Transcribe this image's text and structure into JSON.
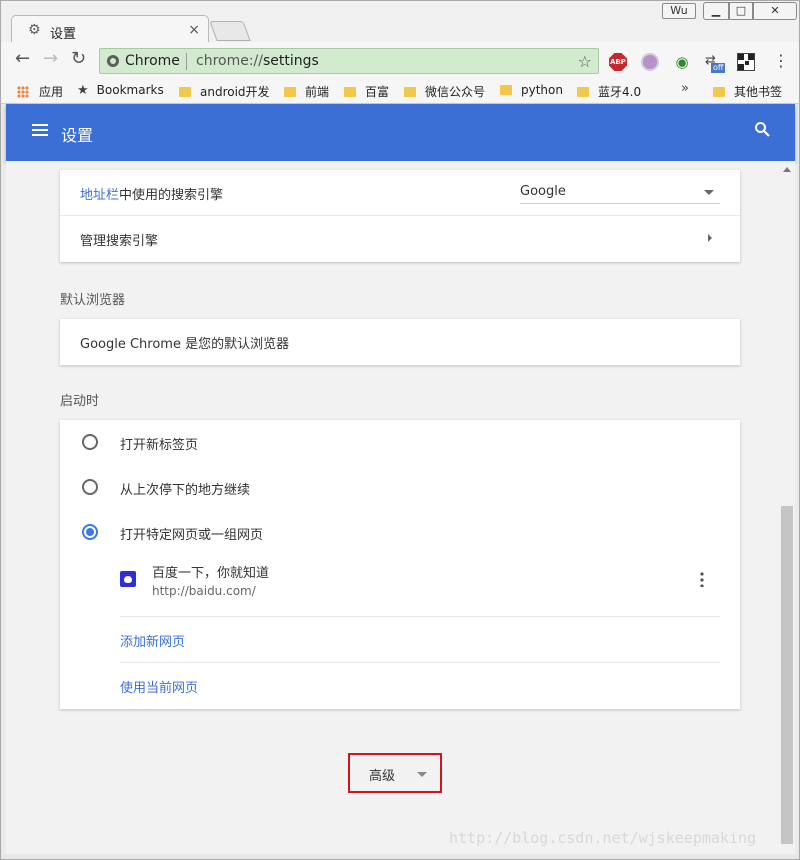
{
  "window": {
    "profile": "Wu",
    "min": "▭",
    "max": "▣",
    "close": "✕"
  },
  "tab": {
    "title": "设置",
    "close": "×"
  },
  "toolbar": {
    "back": "←",
    "forward": "→",
    "reload": "↻",
    "site_name": "Chrome",
    "url_scheme": "chrome://",
    "url_path": "settings",
    "star": "☆",
    "ext_abp": "ABP",
    "ext_off_badge": "off",
    "menu": "⋮"
  },
  "bookmarks": {
    "apps": "应用",
    "items": [
      "Bookmarks",
      "android开发",
      "前端",
      "百富",
      "微信公众号",
      "python",
      "蓝牙4.0"
    ],
    "more": "»",
    "other": "其他书签"
  },
  "appbar": {
    "title": "设置"
  },
  "search_engine": {
    "label_link": "地址栏",
    "label_rest": "中使用的搜索引擎",
    "selected": "Google",
    "manage": "管理搜索引擎"
  },
  "default_browser": {
    "section": "默认浏览器",
    "status": "Google Chrome 是您的默认浏览器"
  },
  "startup": {
    "section": "启动时",
    "options": [
      "打开新标签页",
      "从上次停下的地方继续",
      "打开特定网页或一组网页"
    ],
    "selected_index": 2,
    "page_title": "百度一下，你就知道",
    "page_url": "http://baidu.com/",
    "add_page": "添加新网页",
    "use_current": "使用当前网页"
  },
  "advanced": {
    "label": "高级"
  },
  "watermark": "http://blog.csdn.net/wjskeepmaking",
  "colors": {
    "accent": "#3b6fd6",
    "radio_on": "#3b78e7",
    "highlight_box": "#d0161a"
  }
}
